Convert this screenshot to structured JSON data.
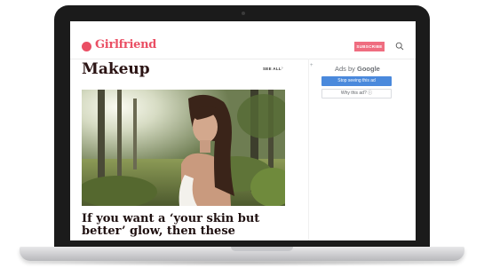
{
  "site": {
    "logo_text": "Girlfriend",
    "subscribe_label": "SUBSCRIBE",
    "search_icon": "search-icon",
    "brand_color": "#ea4f64"
  },
  "main": {
    "section_title": "Makeup",
    "see_all_label": "SEE ALL",
    "see_all_chevron": "›",
    "headline": "If you want a ‘your skin but better’ glow, then these"
  },
  "ad": {
    "ads_by_prefix": "Ads by ",
    "ads_by_brand": "Google",
    "stop_label": "Stop seeing this ad",
    "why_label": "Why this ad? ⓘ",
    "plus": "+"
  }
}
